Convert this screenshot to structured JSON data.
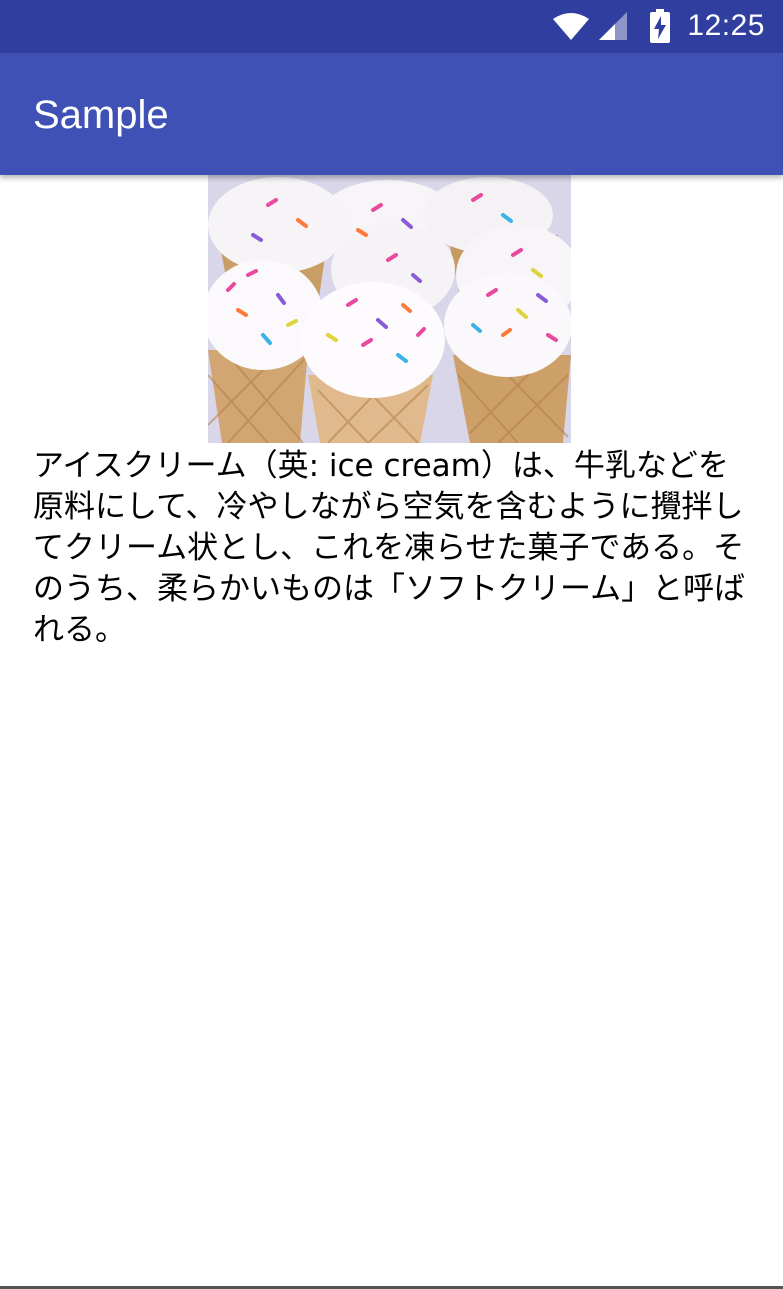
{
  "status_bar": {
    "time": "12:25",
    "icons": [
      "wifi-icon",
      "cell-signal-icon",
      "battery-charging-icon"
    ],
    "color": "#303f9f"
  },
  "app_bar": {
    "title": "Sample",
    "color": "#3f51b5"
  },
  "content": {
    "image": {
      "alt_subject": "cupcake-cones-with-sprinkles"
    },
    "paragraph": "アイスクリーム（英: ice cream）は、牛乳などを原料にして、冷やしながら空気を含むように攪拌してクリーム状とし、これを凍らせた菓子である。そのうち、柔らかいものは「ソフトクリーム」と呼ばれる。"
  }
}
